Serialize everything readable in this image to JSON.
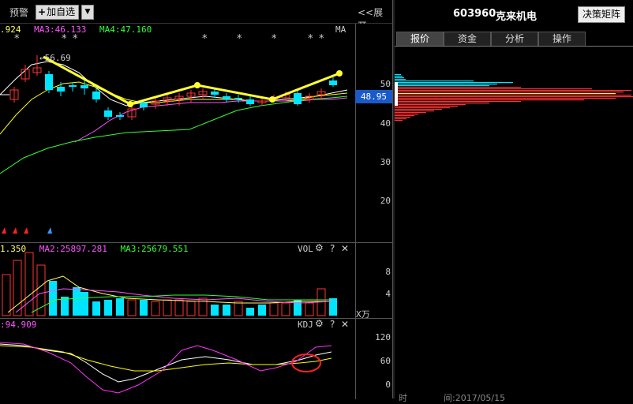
{
  "toolbar": {
    "warning_label": "预警",
    "add_label": "加自选",
    "add_plus": "+",
    "dropdown_arrow": "▼",
    "expand_label": "<<展开"
  },
  "kline": {
    "ma_legend": [
      {
        "text": ".924",
        "color": "#ffffff"
      },
      {
        "text": "MA3:46.133",
        "color": "#ff55ff"
      },
      {
        "text": "MA4:47.160",
        "color": "#33ff33"
      }
    ],
    "ma_label": "MA",
    "stars": [
      "*",
      "*",
      "*",
      "*",
      "*",
      "*",
      "*",
      "*"
    ],
    "high_label": "←56.69",
    "axis_ticks": [
      "50",
      "40",
      "30",
      "20"
    ]
  },
  "current_price": "48.95",
  "volume": {
    "legend": [
      {
        "text": "1.350",
        "color": "#ffffff"
      },
      {
        "text": "MA2:25897.281",
        "color": "#ff55ff"
      },
      {
        "text": "MA3:25679.551",
        "color": "#33ff33"
      }
    ],
    "title": "VOL",
    "unit": "X万",
    "axis_ticks": [
      "8",
      "4"
    ]
  },
  "kdj": {
    "legend": [
      {
        "text": ":94.909",
        "color": "#ff55ff"
      }
    ],
    "title": "KDJ",
    "axis_ticks": [
      "120",
      "60",
      "0"
    ]
  },
  "controls": {
    "gear": "⚙",
    "question": "?",
    "close": "✕"
  },
  "right_panel": {
    "stock_code": "603960",
    "stock_name": "克来机电",
    "matrix_button": "决策矩阵",
    "tabs": [
      "报价",
      "资金",
      "分析",
      "操作"
    ],
    "active_tab": "报价"
  },
  "bottom": {
    "time_label": "时",
    "date_text": "间:2017/05/15"
  },
  "colors": {
    "up": "#ff3333",
    "down": "#00e5ff",
    "ma5": "#ffffff",
    "ma10": "#ffff00",
    "ma20": "#ff55ff",
    "ma60": "#33ff33",
    "arrow": "#ffff33"
  }
}
